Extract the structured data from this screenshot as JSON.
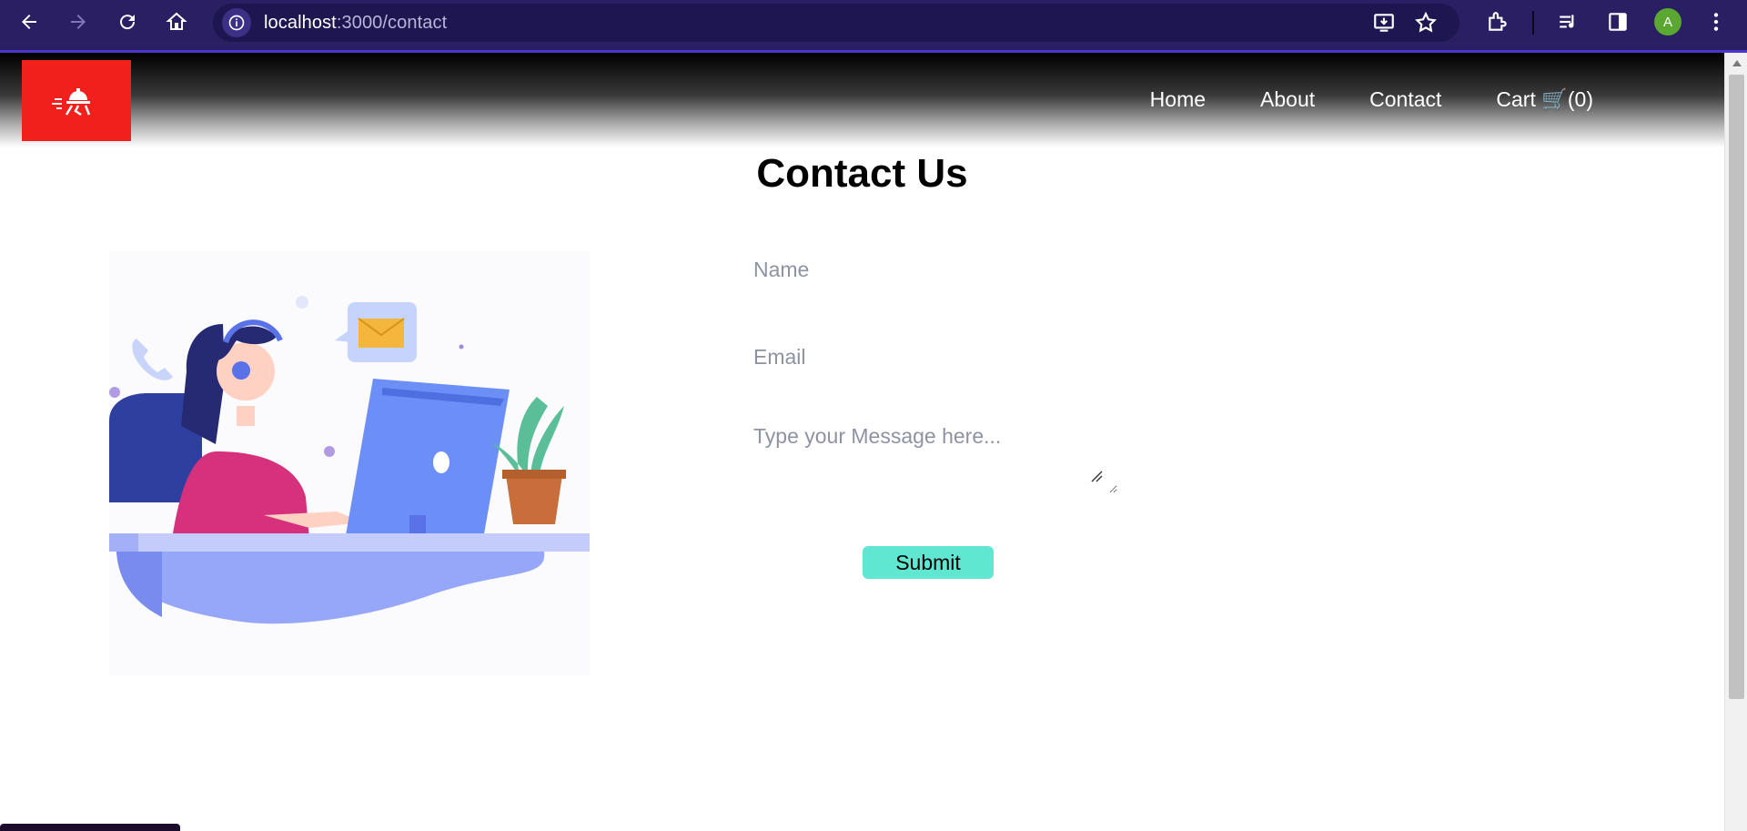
{
  "browser": {
    "url_host": "localhost",
    "url_path": ":3000/contact",
    "profile_initial": "A",
    "icons": [
      "back-arrow-icon",
      "forward-arrow-icon",
      "reload-icon",
      "home-icon",
      "site-info-icon",
      "install-app-icon",
      "bookmark-star-icon",
      "extensions-icon",
      "media-control-icon",
      "side-panel-icon",
      "more-menu-icon"
    ]
  },
  "header": {
    "logo_alt": "restaurant bell logo",
    "nav": [
      {
        "label": "Home"
      },
      {
        "label": "About"
      },
      {
        "label": "Contact"
      },
      {
        "label": "Cart 🛒(0)"
      }
    ]
  },
  "main": {
    "title": "Contact Us",
    "form": {
      "name_placeholder": "Name",
      "email_placeholder": "Email",
      "message_placeholder": "Type your Message here...",
      "submit_label": "Submit"
    }
  },
  "colors": {
    "chrome_bg": "#2a1f63",
    "logo_bg": "#f2201c",
    "submit_bg": "#5fe7d2",
    "illustration_blue": "#6b8ff7",
    "illustration_pink": "#d6317c"
  }
}
